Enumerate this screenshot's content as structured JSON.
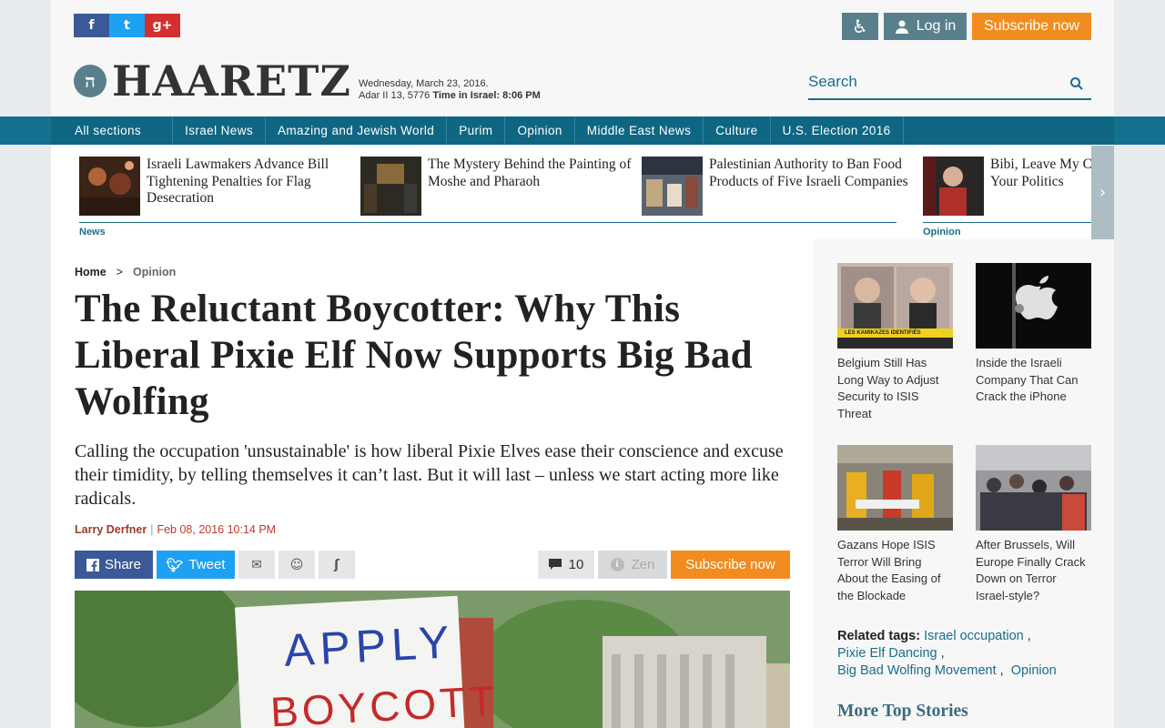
{
  "header": {
    "social": [
      "f",
      "t",
      "g+"
    ],
    "login_label": "Log in",
    "subscribe_label": "Subscribe now",
    "logo_text": "HAARETZ",
    "logo_mark": "ה",
    "date_line1": "Wednesday, March 23, 2016.",
    "date_line2_a": "Adar II 13, 5776 ",
    "date_line2_b": "Time in Israel: 8:06 PM",
    "search_placeholder": "Search"
  },
  "nav": {
    "items": [
      "All sections",
      "Israel News",
      "Amazing and Jewish World",
      "Purim",
      "Opinion",
      "Middle East News",
      "Culture",
      "U.S. Election 2016"
    ]
  },
  "teasers": [
    {
      "title": "Israeli Lawmakers Advance Bill Tightening Penalties for Flag Desecration"
    },
    {
      "title": "The Mystery Behind the Painting of Moshe and Pharaoh"
    },
    {
      "title": "Palestinian Authority to Ban Food Products of Five Israeli Companies"
    },
    {
      "title": "Bibi, Leave My Country Out of Your Politics"
    }
  ],
  "teaser_labels": {
    "news": "News",
    "opinion": "Opinion"
  },
  "breadcrumb": {
    "home": "Home",
    "sep": ">",
    "current": "Opinion"
  },
  "article": {
    "title": "The Reluctant Boycotter: Why This Liberal Pixie Elf Now Supports Big Bad Wolfing",
    "dek": "Calling the occupation 'unsustainable' is how liberal Pixie Elves ease their conscience and excuse their timidity, by telling themselves it can’t last. But it will last – unless we start acting more like radicals.",
    "author": "Larry Derfner",
    "byline_sep": "|",
    "date": "Feb 08, 2016 10:14 PM",
    "share_label": "Share",
    "tweet_label": "Tweet",
    "comments_count": "10",
    "zen_label": "Zen",
    "subscribe_label": "Subscribe now",
    "hero_sign_line1": "APPLY",
    "hero_sign_line2": "BOYCOTT"
  },
  "sidebar": {
    "items": [
      {
        "title": "Belgium Still Has Long Way to Adjust Security to ISIS Threat",
        "caption": "LES KAMIKAZES IDENTIFIÉS"
      },
      {
        "title": "Inside the Israeli Company That Can Crack the iPhone"
      },
      {
        "title": "Gazans Hope ISIS Terror Will Bring About the Easing of the Blockade"
      },
      {
        "title": "After Brussels, Will Europe Finally Crack Down on Terror Israel-style?"
      }
    ],
    "tags_label": "Related tags:",
    "tags": [
      "Israel occupation",
      "Pixie Elf Dancing",
      "Big Bad Wolfing Movement",
      "Opinion"
    ],
    "more_label": "More Top Stories"
  },
  "colors": {
    "accent": "#13708f",
    "subscribe": "#f28c1e",
    "byline": "#c0392b"
  }
}
